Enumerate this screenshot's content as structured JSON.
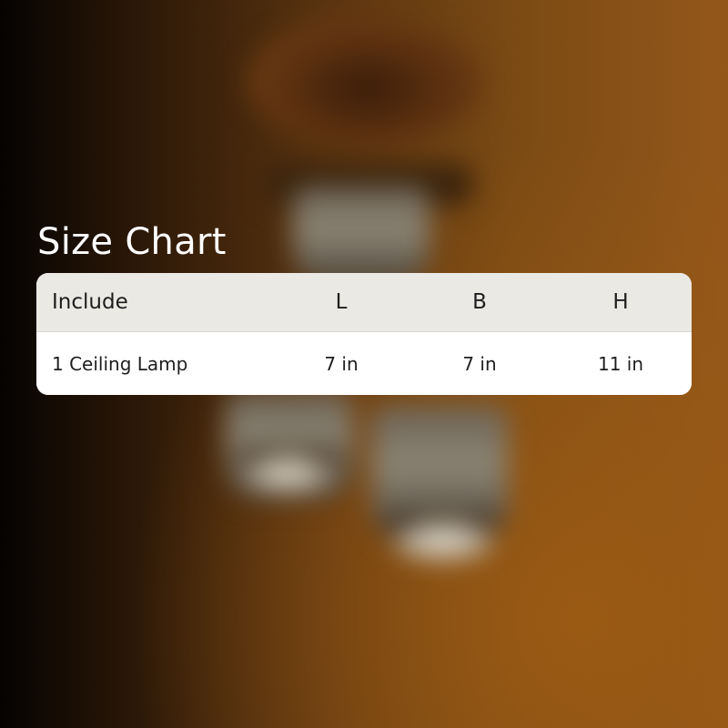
{
  "size_chart": {
    "title": "Size Chart",
    "columns": [
      "Include",
      "L",
      "B",
      "H"
    ],
    "rows": [
      [
        "1 Ceiling Lamp",
        "7 in",
        "7 in",
        "11 in"
      ]
    ]
  },
  "colors": {
    "title_text": "#ffffff",
    "header_bg": "#ebe9e4",
    "body_bg": "#ffffff",
    "cell_text": "#1e1e1e",
    "background_warm": "#94571a"
  }
}
